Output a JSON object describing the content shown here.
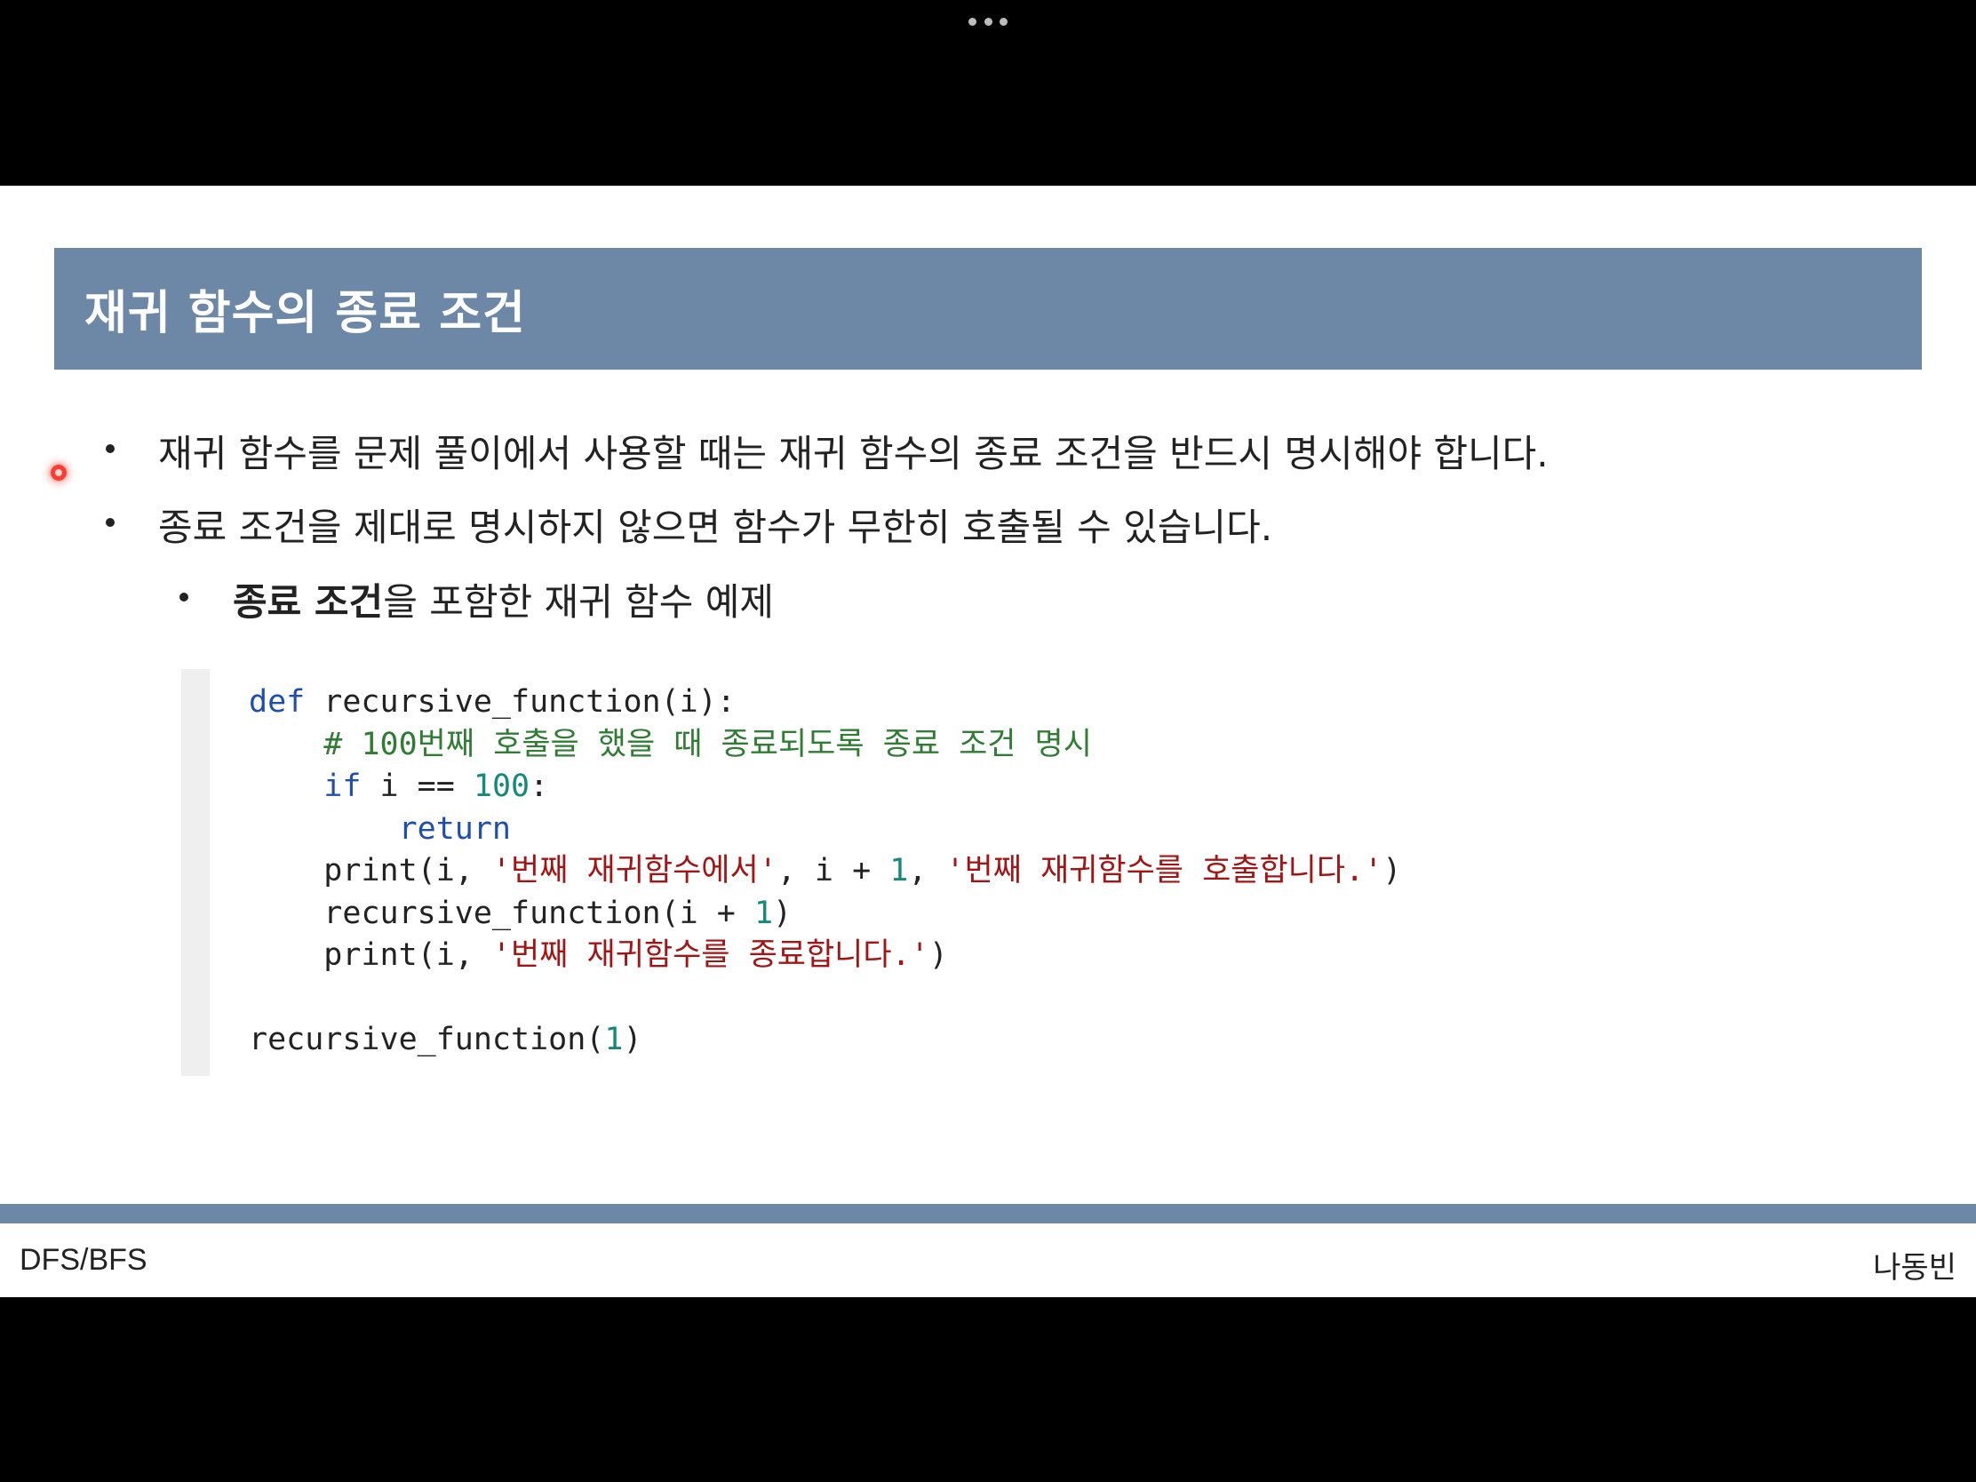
{
  "slide": {
    "title": "재귀 함수의 종료 조건",
    "bullets": [
      "재귀 함수를 문제 풀이에서 사용할 때는 재귀 함수의 종료 조건을 반드시 명시해야 합니다.",
      "종료 조건을 제대로 명시하지 않으면 함수가 무한히 호출될 수 있습니다."
    ],
    "sub_bullet": {
      "bold": "종료 조건",
      "rest": "을 포함한 재귀 함수 예제"
    },
    "code": {
      "line1": {
        "kw": "def",
        "rest": " recursive_function(i):"
      },
      "line2": {
        "indent": "    ",
        "comment": "# 100번째 호출을 했을 때 종료되도록 종료 조건 명시"
      },
      "line3": {
        "indent": "    ",
        "kw": "if",
        "mid": " i == ",
        "num": "100",
        "end": ":"
      },
      "line4": {
        "indent": "        ",
        "kw": "return"
      },
      "line5": {
        "indent": "    ",
        "p1": "print(i, ",
        "s1": "'번째 재귀함수에서'",
        "p2": ", i + ",
        "n1": "1",
        "p3": ", ",
        "s2": "'번째 재귀함수를 호출합니다.'",
        "p4": ")"
      },
      "line6": {
        "indent": "    ",
        "p1": "recursive_function(i + ",
        "n1": "1",
        "p2": ")"
      },
      "line7": {
        "indent": "    ",
        "p1": "print(i, ",
        "s1": "'번째 재귀함수를 종료합니다.'",
        "p2": ")"
      },
      "line9": {
        "p1": "recursive_function(",
        "n1": "1",
        "p2": ")"
      }
    }
  },
  "footer": {
    "left": "DFS/BFS",
    "right": "나동빈"
  },
  "colors": {
    "title_bar": "#6d88a6",
    "keyword": "#1f4fae",
    "comment": "#2e7d32",
    "number": "#138a7b",
    "string": "#a31515",
    "pointer": "#ff3b2f"
  },
  "icons": {
    "top_menu": "more-dots-icon",
    "pointer": "laser-pointer-icon"
  }
}
